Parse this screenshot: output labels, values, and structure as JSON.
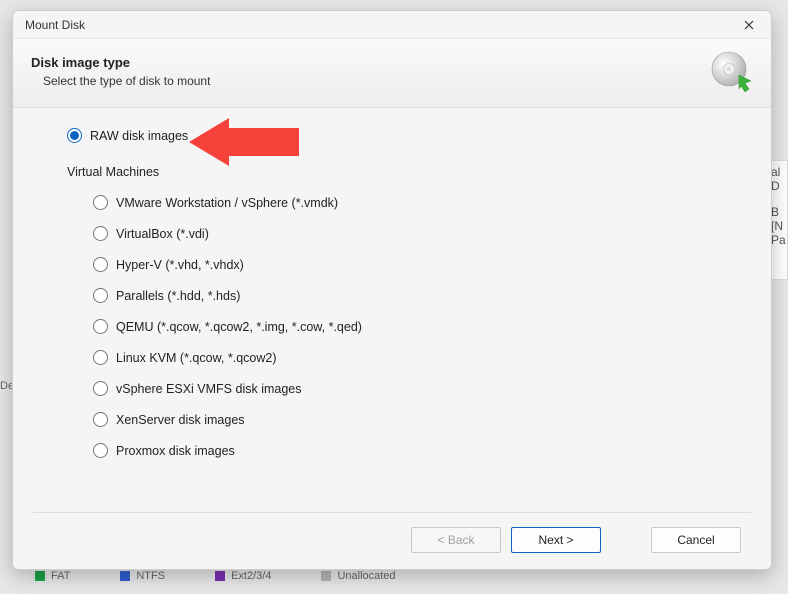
{
  "window": {
    "title": "Mount Disk"
  },
  "header": {
    "title": "Disk image type",
    "subtitle": "Select the type of disk to mount"
  },
  "options": {
    "raw": {
      "label": "RAW disk images",
      "selected": true
    },
    "section": "Virtual Machines",
    "vm": [
      {
        "id": "vmware",
        "label": "VMware Workstation / vSphere (*.vmdk)"
      },
      {
        "id": "vbox",
        "label": "VirtualBox (*.vdi)"
      },
      {
        "id": "hyperv",
        "label": "Hyper-V (*.vhd, *.vhdx)"
      },
      {
        "id": "parallels",
        "label": "Parallels (*.hdd, *.hds)"
      },
      {
        "id": "qemu",
        "label": "QEMU (*.qcow, *.qcow2, *.img, *.cow, *.qed)"
      },
      {
        "id": "kvm",
        "label": "Linux KVM (*.qcow, *.qcow2)"
      },
      {
        "id": "esxi",
        "label": "vSphere ESXi VMFS disk images"
      },
      {
        "id": "xen",
        "label": "XenServer disk images"
      },
      {
        "id": "proxmox",
        "label": "Proxmox disk images"
      }
    ]
  },
  "buttons": {
    "back": "< Back",
    "next": "Next >",
    "cancel": "Cancel"
  },
  "background": {
    "left_label": "Dev",
    "right_snip1": "al D",
    "right_snip2": "B [N",
    "right_snip3": "Pa",
    "legend": [
      {
        "label": "FAT",
        "color": "#1aa34a"
      },
      {
        "label": "NTFS",
        "color": "#2f5fd1"
      },
      {
        "label": "Ext2/3/4",
        "color": "#7a2fb3"
      },
      {
        "label": "Unallocated",
        "color": "#b5b5b5"
      }
    ]
  }
}
